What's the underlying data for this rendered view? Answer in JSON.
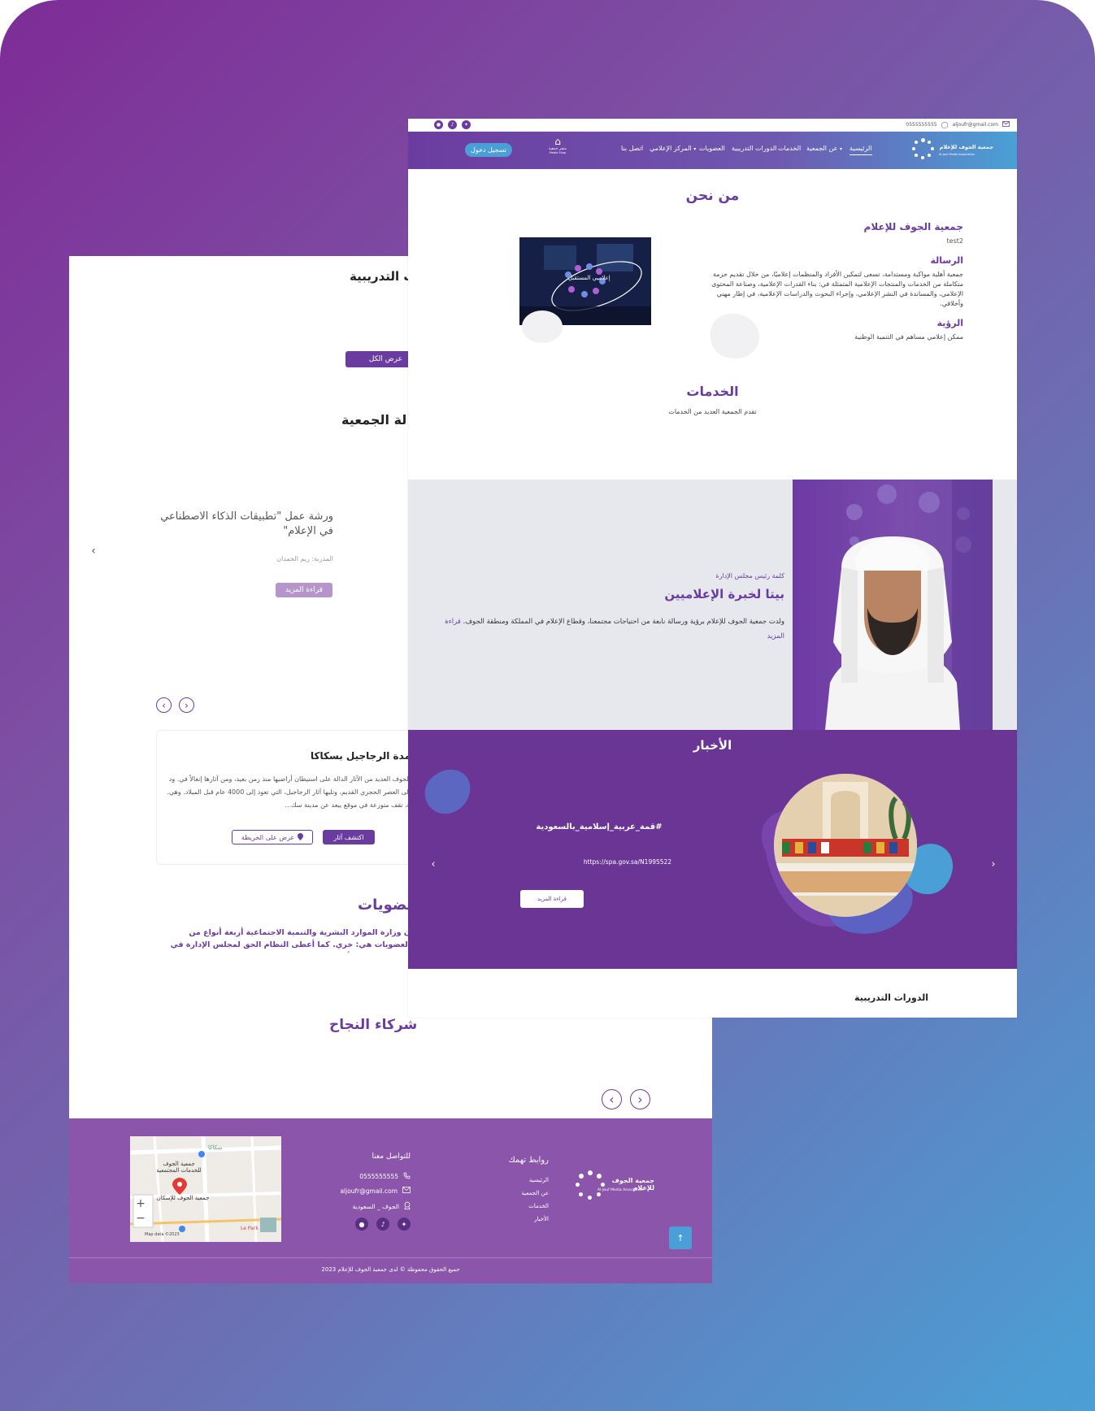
{
  "topbar": {
    "email": "aljoufr@gmail.com",
    "phone": "0555555555"
  },
  "nav": {
    "logo_text": "جمعية الجوف للإعلام",
    "logo_sub": "Al-Jouf Media Association",
    "items": [
      {
        "label": "الرئيسية",
        "active": true
      },
      {
        "label": "عن الجمعية",
        "dropdown": true
      },
      {
        "label": "الخدمات"
      },
      {
        "label": "الدورات التدريبية"
      },
      {
        "label": "العضويات"
      },
      {
        "label": "المركز الإعلامي",
        "dropdown": true
      },
      {
        "label": "اتصل بنا"
      }
    ],
    "store_label": "متجر جمعية",
    "store_sub": "Media Shop",
    "login_label": "تسجيل دخول"
  },
  "about": {
    "title": "من نحن",
    "org_name": "جمعية الجوف للإعلام",
    "org_sub": "test2",
    "mission_title": "الرسالة",
    "mission_text": "جمعية أهلية مواكبة ومستدامة، تسعى لتمكين الأفراد والمنظمات إعلاميًا، من خلال تقديم حزمة متكاملة من الخدمات والمنتجات الإعلامية المتمثلة في: بناء القدرات الإعلامية، وصناعة المحتوى الإعلامي، والمساندة في النشر الإعلامي، وإجراء البحوث والدراسات الإعلامية، في إطار مهني وأخلاقي.",
    "vision_title": "الرؤية",
    "vision_text": "ممكن إعلامي مساهم في التنمية الوطنية",
    "image_caption": "إعلاميي المستقبل"
  },
  "services": {
    "title": "الخدمات",
    "subtitle": "تقدم الجمعية العديد من الخدمات"
  },
  "chairman": {
    "kicker": "كلمة رئيس مجلس الإدارة",
    "title": "بيتا لخبرة الإعلاميين",
    "text": "ولدت جمعية الجوف للإعلام برؤية ورسالة نابعة من احتياجات مجتمعنا، وقطاع الإعلام في المملكة ومنطقة الجوف.",
    "read_more": "قراءة المزيد"
  },
  "news": {
    "title": "الأخبار",
    "headline": "#قمة_عربية_إسلامية_بالسعودية",
    "link": "https://spa.gov.sa/N1995522",
    "read_more": "قراءة المزيد"
  },
  "front_footer_title": "الدورات التدريبية",
  "back": {
    "courses_title": "رات التدريبية",
    "view_all": "عرض الكل",
    "assoc_title": "لة الجمعية",
    "workshop_title": "ورشة عمل \"تطبيقات الذكاء الاصطناعي في الإعلام\"",
    "workshop_trainer": "المدربة: ريم الحمدان",
    "workshop_more": "قراءة المزيد",
    "site_title": "مدة الرجاجيل بسكاكا",
    "site_text": "الجوف العديد من الآثار الدالة على استيطان أراضيها منذ زمن بعيد، ومن آثارها إنغالاً في. ود إلى العصر الحجري القديم، وتليها آثار الرجاجيل، التي تعود إلى 4000 عام قبل الميلاد. وهي. ة، تقف متوزعة في موقع يبعد عن مدينة سك...",
    "site_btn_explore": "اكتشف آثار",
    "site_btn_map": "عرض على الخريطة",
    "membership_title": "عضويات",
    "membership_text": "ن وزارة الموارد البشرية والتنمية الاجتماعية أربعة أنواع من العضويات هي: خري. كما أعطى النظام الحق لمجلس الإدارة في اقتراح عضويات أخرى.",
    "partners_title": "شركاء النجاح"
  },
  "footer": {
    "logo_text": "جمعية الجوف للإعلام",
    "logo_sub": "Al-Jouf Media Association",
    "links_title": "روابط تهمك",
    "links": [
      "الرئيسية",
      "عن الجمعية",
      "الخدمات",
      "الأخبار"
    ],
    "contact_title": "للتواصل معنا",
    "phone": "0555555555",
    "email": "aljoufr@gmail.com",
    "location": "الجوف _ السعودية",
    "copyright": "جميع الحقوق محفوظة © لدى جمعية الجوف للإعلام 2023",
    "map_label_1": "جمعية الجوف للخدمات المجتمعية",
    "map_label_2": "جمعية الجوف للإسكان",
    "map_label_3": "سكاكا",
    "map_label_4": "Le Park",
    "map_attrib": "Map data ©2023"
  },
  "colors": {
    "primary": "#6b3ca0",
    "accent": "#4aa0d6",
    "news_bg": "#6a3595",
    "footer_bg": "#8a55aa"
  },
  "icons": [
    "email-icon",
    "whatsapp-icon",
    "twitter-icon",
    "tiktok-icon",
    "snapchat-icon",
    "chevron-left-icon",
    "chevron-right-icon",
    "phone-icon",
    "location-icon",
    "arrow-up-icon",
    "map-pin-icon"
  ]
}
